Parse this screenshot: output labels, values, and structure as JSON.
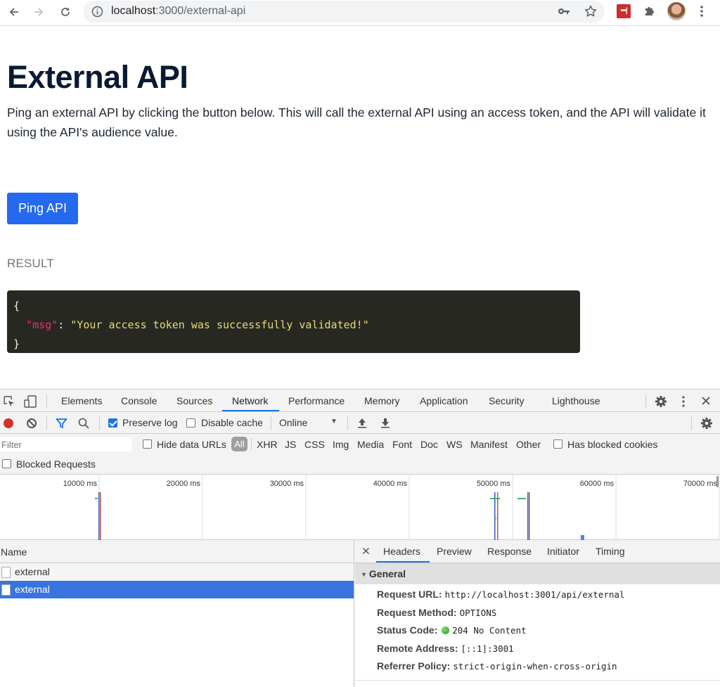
{
  "browser": {
    "url_host": "localhost",
    "url_path": ":3000/external-api",
    "extension_badge": "•••|"
  },
  "page": {
    "title": "External API",
    "lead": "Ping an external API by clicking the button below. This will call the external API using an access token, and the API will validate it using the API's audience value.",
    "ping_button": "Ping API",
    "result_label": "RESULT",
    "result_json": {
      "open": "{",
      "key": "\"msg\"",
      "colon": ": ",
      "value": "\"Your access token was successfully validated!\"",
      "close": "}"
    },
    "colors": {
      "accent": "#2469f0",
      "code_bg": "#272822",
      "code_key": "#f92672",
      "code_string": "#e6db74"
    }
  },
  "devtools": {
    "tabs": [
      "Elements",
      "Console",
      "Sources",
      "Network",
      "Performance",
      "Memory",
      "Application",
      "Security",
      "Lighthouse"
    ],
    "active_tab": "Network",
    "toolbar": {
      "preserve_log": "Preserve log",
      "preserve_log_checked": true,
      "disable_cache": "Disable cache",
      "disable_cache_checked": false,
      "throttling": "Online"
    },
    "filter": {
      "placeholder": "Filter",
      "hide_data_urls": "Hide data URLs",
      "all": "All",
      "types": [
        "XHR",
        "JS",
        "CSS",
        "Img",
        "Media",
        "Font",
        "Doc",
        "WS",
        "Manifest",
        "Other"
      ],
      "has_blocked_cookies": "Has blocked cookies",
      "blocked_requests": "Blocked Requests"
    },
    "overview": {
      "ticks": [
        "10000 ms",
        "20000 ms",
        "30000 ms",
        "40000 ms",
        "50000 ms",
        "60000 ms",
        "70000 ms"
      ]
    },
    "requests": {
      "column": "Name",
      "rows": [
        {
          "name": "external",
          "selected": false
        },
        {
          "name": "external",
          "selected": true
        }
      ]
    },
    "details": {
      "tabs": [
        "Headers",
        "Preview",
        "Response",
        "Initiator",
        "Timing"
      ],
      "active_tab": "Headers",
      "section": "General",
      "fields": [
        {
          "key": "Request URL:",
          "value": "http://localhost:3001/api/external"
        },
        {
          "key": "Request Method:",
          "value": "OPTIONS"
        },
        {
          "key": "Status Code:",
          "value": "204 No Content",
          "status_dot": "green"
        },
        {
          "key": "Remote Address:",
          "value": "[::1]:3001"
        },
        {
          "key": "Referrer Policy:",
          "value": "strict-origin-when-cross-origin"
        }
      ]
    }
  }
}
